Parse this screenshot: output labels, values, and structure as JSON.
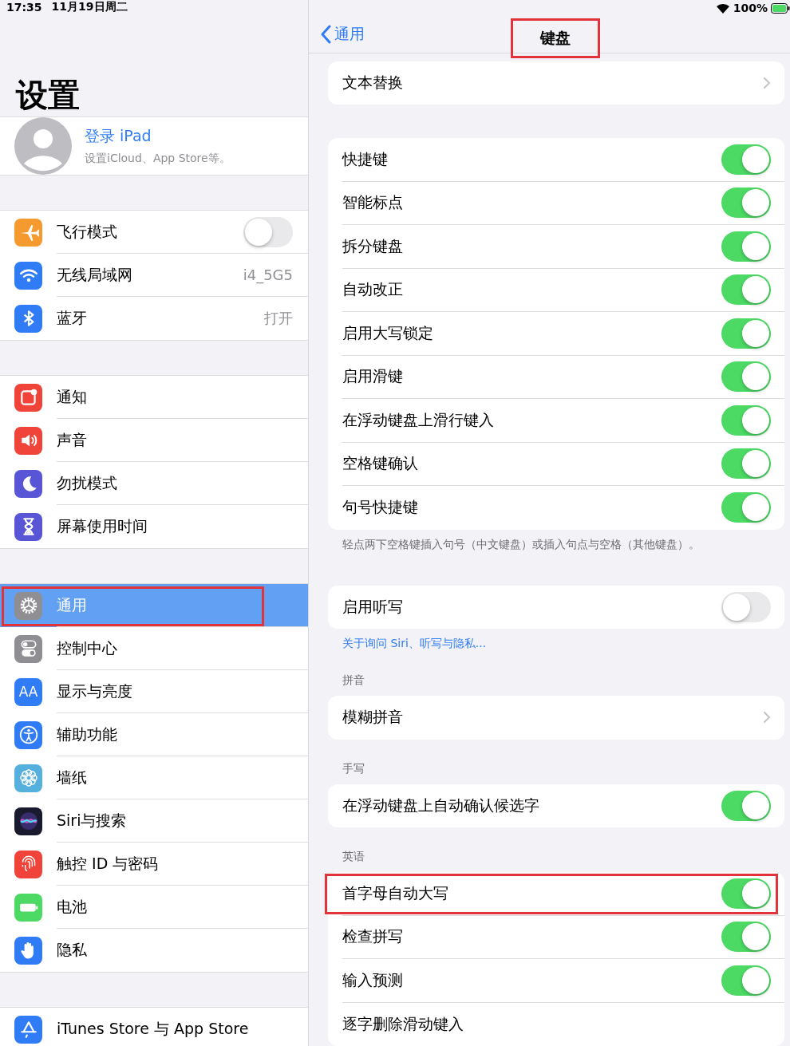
{
  "status_bar": {
    "time": "17:35",
    "date": "11月19日周二",
    "battery": "100%"
  },
  "sidebar": {
    "title": "设置",
    "profile": {
      "name": "登录 iPad",
      "subtitle": "设置iCloud、App Store等。"
    },
    "groups": [
      [
        {
          "label": "飞行模式",
          "kind": "toggle",
          "on": false,
          "selected": false,
          "highlighted": false
        },
        {
          "label": "无线局域网",
          "kind": "value",
          "value": "i4_5G5",
          "selected": false,
          "highlighted": false
        },
        {
          "label": "蓝牙",
          "kind": "value",
          "value": "打开",
          "selected": false,
          "highlighted": false
        }
      ],
      [
        {
          "label": "通知",
          "kind": "link",
          "selected": false,
          "highlighted": false
        },
        {
          "label": "声音",
          "kind": "link",
          "selected": false,
          "highlighted": false
        },
        {
          "label": "勿扰模式",
          "kind": "link",
          "selected": false,
          "highlighted": false
        },
        {
          "label": "屏幕使用时间",
          "kind": "link",
          "selected": false,
          "highlighted": false
        }
      ],
      [
        {
          "label": "通用",
          "kind": "link",
          "selected": true,
          "highlighted": true
        },
        {
          "label": "控制中心",
          "kind": "link",
          "selected": false,
          "highlighted": false
        },
        {
          "label": "显示与亮度",
          "icon_text": "AA",
          "kind": "link",
          "selected": false,
          "highlighted": false
        },
        {
          "label": "辅助功能",
          "kind": "link",
          "selected": false,
          "highlighted": false
        },
        {
          "label": "墙纸",
          "kind": "link",
          "selected": false,
          "highlighted": false
        },
        {
          "label": "Siri与搜索",
          "kind": "link",
          "selected": false,
          "highlighted": false
        },
        {
          "label": "触控 ID 与密码",
          "kind": "link",
          "selected": false,
          "highlighted": false
        },
        {
          "label": "电池",
          "kind": "link",
          "selected": false,
          "highlighted": false
        },
        {
          "label": "隐私",
          "kind": "link",
          "selected": false,
          "highlighted": false
        }
      ],
      [
        {
          "label": "iTunes Store 与 App Store",
          "kind": "link",
          "selected": false,
          "highlighted": false
        }
      ]
    ]
  },
  "nav": {
    "back": "通用",
    "title": "键盘",
    "highlighted": true
  },
  "sections": [
    {
      "rows": [
        {
          "label": "文本替换",
          "kind": "chevron",
          "highlighted": false
        }
      ]
    },
    {
      "rows": [
        {
          "label": "快捷键",
          "kind": "toggle",
          "on": true,
          "highlighted": false
        },
        {
          "label": "智能标点",
          "kind": "toggle",
          "on": true,
          "highlighted": false
        },
        {
          "label": "拆分键盘",
          "kind": "toggle",
          "on": true,
          "highlighted": false
        },
        {
          "label": "自动改正",
          "kind": "toggle",
          "on": true,
          "highlighted": false
        },
        {
          "label": "启用大写锁定",
          "kind": "toggle",
          "on": true,
          "highlighted": false
        },
        {
          "label": "启用滑键",
          "kind": "toggle",
          "on": true,
          "highlighted": false
        },
        {
          "label": "在浮动键盘上滑行键入",
          "kind": "toggle",
          "on": true,
          "highlighted": false
        },
        {
          "label": "空格键确认",
          "kind": "toggle",
          "on": true,
          "highlighted": false
        },
        {
          "label": "句号快捷键",
          "kind": "toggle",
          "on": true,
          "highlighted": false
        }
      ],
      "footer": {
        "kind": "note",
        "text": "轻点两下空格键插入句号（中文键盘）或插入句点与空格（其他键盘）。"
      }
    },
    {
      "rows": [
        {
          "label": "启用听写",
          "kind": "toggle",
          "on": false,
          "highlighted": false
        }
      ],
      "footer": {
        "kind": "link",
        "text": "关于询问 Siri、听写与隐私..."
      }
    },
    {
      "header": "拼音",
      "rows": [
        {
          "label": "模糊拼音",
          "kind": "chevron",
          "highlighted": false
        }
      ]
    },
    {
      "header": "手写",
      "rows": [
        {
          "label": "在浮动键盘上自动确认候选字",
          "kind": "toggle",
          "on": true,
          "highlighted": false
        }
      ]
    },
    {
      "header": "英语",
      "rows": [
        {
          "label": "首字母自动大写",
          "kind": "toggle",
          "on": true,
          "highlighted": true
        },
        {
          "label": "检查拼写",
          "kind": "toggle",
          "on": true,
          "highlighted": false
        },
        {
          "label": "输入预测",
          "kind": "toggle",
          "on": true,
          "highlighted": false
        },
        {
          "label": "逐字删除滑动键入",
          "kind": "plain",
          "highlighted": false
        }
      ]
    }
  ]
}
